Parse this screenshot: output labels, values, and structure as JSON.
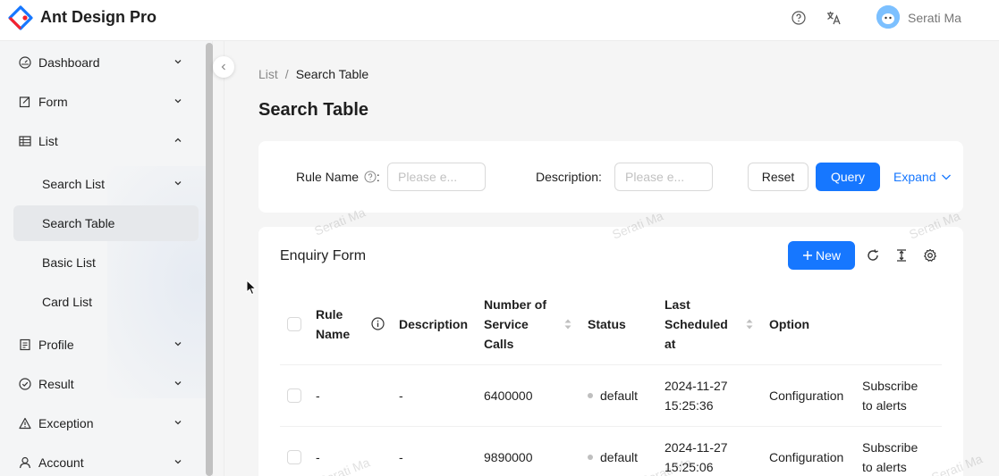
{
  "header": {
    "brand": "Ant Design Pro",
    "username": "Serati Ma",
    "icons": [
      "question-circle-icon",
      "translate-icon"
    ]
  },
  "sidebar": {
    "items": [
      {
        "label": "Dashboard",
        "icon": "dashboard-icon",
        "chevron": "down"
      },
      {
        "label": "Form",
        "icon": "form-icon",
        "chevron": "down"
      },
      {
        "label": "List",
        "icon": "table-icon",
        "chevron": "up"
      },
      {
        "label": "Search List",
        "chevron": "down"
      },
      {
        "label": "Search Table",
        "active": true
      },
      {
        "label": "Basic List"
      },
      {
        "label": "Card List"
      },
      {
        "label": "Profile",
        "icon": "profile-icon",
        "chevron": "down"
      },
      {
        "label": "Result",
        "icon": "check-circle-icon",
        "chevron": "down"
      },
      {
        "label": "Exception",
        "icon": "warning-icon",
        "chevron": "down"
      },
      {
        "label": "Account",
        "icon": "user-icon",
        "chevron": "down"
      }
    ]
  },
  "breadcrumb": {
    "root": "List",
    "separator": "/",
    "current": "Search Table"
  },
  "page_title": "Search Table",
  "search_form": {
    "rule_name_label": "Rule Name",
    "rule_name_colon": ":",
    "rule_name_placeholder": "Please e...",
    "description_label": "Description",
    "description_colon": ":",
    "description_placeholder": "Please e...",
    "reset_label": "Reset",
    "query_label": "Query",
    "expand_label": "Expand"
  },
  "table": {
    "title": "Enquiry Form",
    "new_label": "New",
    "columns": {
      "rule_name_l1": "Rule",
      "rule_name_l2": "Name",
      "description": "Description",
      "calls_l1": "Number of",
      "calls_l2": "Service",
      "calls_l3": "Calls",
      "status": "Status",
      "scheduled_l1": "Last",
      "scheduled_l2": "Scheduled",
      "scheduled_l3": "at",
      "option": "Option"
    },
    "rows": [
      {
        "rule_name": "-",
        "description": "-",
        "calls": "6400000",
        "status": "default",
        "date": "2024-11-27",
        "time": "15:25:36",
        "config": "Configuration",
        "subscribe_l1": "Subscribe",
        "subscribe_l2": "to alerts"
      },
      {
        "rule_name": "-",
        "description": "-",
        "calls": "9890000",
        "status": "default",
        "date": "2024-11-27",
        "time": "15:25:06",
        "config": "Configuration",
        "subscribe_l1": "Subscribe",
        "subscribe_l2": "to alerts"
      }
    ]
  },
  "watermark": "Serati Ma",
  "colors": {
    "primary": "#1677ff",
    "status_default": "#bfbfbf"
  }
}
